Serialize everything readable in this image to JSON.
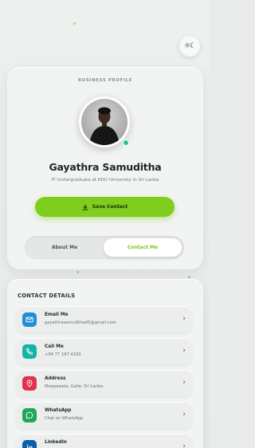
{
  "header": {
    "theme_toggle_icon": "sun-moon-icon",
    "theme_glyph": "☼☾"
  },
  "profile": {
    "eyebrow": "BUSINESS PROFILE",
    "name": "Gayathra Samuditha",
    "subtitle": "IT Undergraduate at KDU University in Sri Lanka",
    "status_color": "#22c38e",
    "save_button": {
      "label": "Save Contact",
      "icon": "download-icon"
    },
    "tabs": [
      {
        "label": "About Me",
        "active": false
      },
      {
        "label": "Contact Me",
        "active": true
      }
    ]
  },
  "contact": {
    "title": "CONTACT DETAILS",
    "items": [
      {
        "title": "Email Me",
        "value": "gayathrasamuditha45@gmail.com",
        "icon": "mail-icon",
        "color": "#1f8fd8"
      },
      {
        "title": "Call Me",
        "value": "+94 77 197 4163",
        "icon": "phone-icon",
        "color": "#13b3a8"
      },
      {
        "title": "Address",
        "value": "Meepawala, Galle, Sri Lanka",
        "icon": "location-pin-icon",
        "color": "#e0334e"
      },
      {
        "title": "WhatsApp",
        "value": "Chat on WhatsApp",
        "icon": "whatsapp-icon",
        "color": "#1fa85a"
      },
      {
        "title": "LinkedIn",
        "value": "",
        "icon": "linkedin-icon",
        "color": "#0b5ea8"
      }
    ]
  },
  "colors": {
    "accent": "#7fcd1d",
    "background": "#e9eceb"
  }
}
